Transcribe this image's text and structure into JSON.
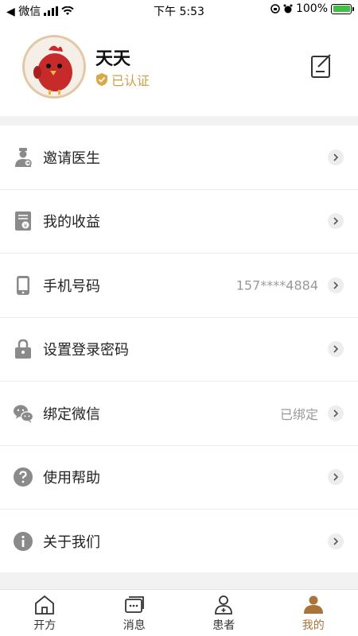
{
  "status_bar": {
    "carrier": "◀ 微信",
    "time": "下午 5:53",
    "battery": "100%"
  },
  "profile": {
    "name": "天天",
    "verified_label": "已认证"
  },
  "menu": [
    {
      "label": "邀请医生",
      "value": "",
      "icon": "doctor-invite-icon"
    },
    {
      "label": "我的收益",
      "value": "",
      "icon": "earnings-icon"
    },
    {
      "label": "手机号码",
      "value": "157****4884",
      "icon": "phone-icon"
    },
    {
      "label": "设置登录密码",
      "value": "",
      "icon": "lock-icon"
    },
    {
      "label": "绑定微信",
      "value": "已绑定",
      "icon": "wechat-icon"
    },
    {
      "label": "使用帮助",
      "value": "",
      "icon": "help-icon"
    },
    {
      "label": "关于我们",
      "value": "",
      "icon": "info-icon"
    }
  ],
  "tabbar": [
    {
      "label": "开方",
      "icon": "prescribe-icon",
      "active": false
    },
    {
      "label": "消息",
      "icon": "message-icon",
      "active": false
    },
    {
      "label": "患者",
      "icon": "patient-icon",
      "active": false
    },
    {
      "label": "我的",
      "icon": "profile-icon",
      "active": true
    }
  ],
  "colors": {
    "accent": "#a9743a",
    "verified": "#c9a04a",
    "icon_gray": "#8a8a8a"
  }
}
